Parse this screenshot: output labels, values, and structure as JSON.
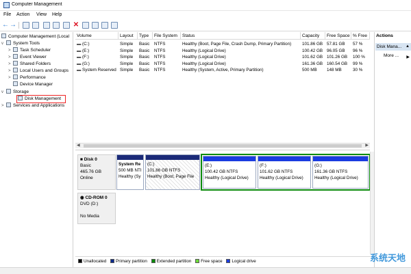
{
  "window": {
    "title": "Computer Management"
  },
  "menu": [
    "File",
    "Action",
    "View",
    "Help"
  ],
  "tree": [
    {
      "label": "Computer Management (Local",
      "indent": 0,
      "expander": ""
    },
    {
      "label": "System Tools",
      "indent": 1,
      "expander": "v"
    },
    {
      "label": "Task Scheduler",
      "indent": 2,
      "expander": ">"
    },
    {
      "label": "Event Viewer",
      "indent": 2,
      "expander": ">"
    },
    {
      "label": "Shared Folders",
      "indent": 2,
      "expander": ">"
    },
    {
      "label": "Local Users and Groups",
      "indent": 2,
      "expander": ">"
    },
    {
      "label": "Performance",
      "indent": 2,
      "expander": ">"
    },
    {
      "label": "Device Manager",
      "indent": 2,
      "expander": ""
    },
    {
      "label": "Storage",
      "indent": 1,
      "expander": "v"
    },
    {
      "label": "Disk Management",
      "indent": 2,
      "expander": ""
    },
    {
      "label": "Services and Applications",
      "indent": 1,
      "expander": ">"
    }
  ],
  "volumes": {
    "columns": [
      "Volume",
      "Layout",
      "Type",
      "File System",
      "Status",
      "Capacity",
      "Free Space",
      "% Free"
    ],
    "rows": [
      [
        "(C:)",
        "Simple",
        "Basic",
        "NTFS",
        "Healthy (Boot, Page File, Crash Dump, Primary Partition)",
        "101.86 GB",
        "57.81 GB",
        "57 %"
      ],
      [
        "(E:)",
        "Simple",
        "Basic",
        "NTFS",
        "Healthy (Logical Drive)",
        "100.42 GB",
        "96.05 GB",
        "96 %"
      ],
      [
        "(F:)",
        "Simple",
        "Basic",
        "NTFS",
        "Healthy (Logical Drive)",
        "101.62 GB",
        "101.26 GB",
        "100 %"
      ],
      [
        "(G:)",
        "Simple",
        "Basic",
        "NTFS",
        "Healthy (Logical Drive)",
        "161.36 GB",
        "160.54 GB",
        "99 %"
      ],
      [
        "System Reserved",
        "Simple",
        "Basic",
        "NTFS",
        "Healthy (System, Active, Primary Partition)",
        "500 MB",
        "148 MB",
        "30 %"
      ]
    ]
  },
  "disks": [
    {
      "name": "Disk 0",
      "type": "Basic",
      "size": "465.76 GB",
      "state": "Online",
      "partitions": [
        {
          "label": "System Re",
          "size": "500 MB NTI",
          "status": "Healthy (Sy"
        },
        {
          "label": "(C:)",
          "size": "101.86 GB NTFS",
          "status": "Healthy (Boot, Page File"
        },
        {
          "label": "(E:)",
          "size": "100.42 GB NTFS",
          "status": "Healthy (Logical Drive)"
        },
        {
          "label": "(F:)",
          "size": "101.62 GB NTFS",
          "status": "Healthy (Logical Drive)"
        },
        {
          "label": "(G:)",
          "size": "161.36 GB NTFS",
          "status": "Healthy (Logical Drive)"
        }
      ]
    },
    {
      "name": "CD-ROM 0",
      "type": "DVD (D:)",
      "state": "No Media"
    }
  ],
  "legend": [
    {
      "label": "Unallocated",
      "color": "#000000"
    },
    {
      "label": "Primary partition",
      "color": "#0a2a8c"
    },
    {
      "label": "Extended partition",
      "color": "#0a8a0a"
    },
    {
      "label": "Free space",
      "color": "#6ddc3a"
    },
    {
      "label": "Logical drive",
      "color": "#1a3ce0"
    }
  ],
  "actions": {
    "header": "Actions",
    "selected": "Disk Mana...",
    "more": "More ..."
  },
  "watermark": "系统天地",
  "colors": {
    "primary_bar": "#1b2a78",
    "logical_bar": "#1a3ce0",
    "extended": "#0a8a0a",
    "highlight_box": "#e22222"
  }
}
